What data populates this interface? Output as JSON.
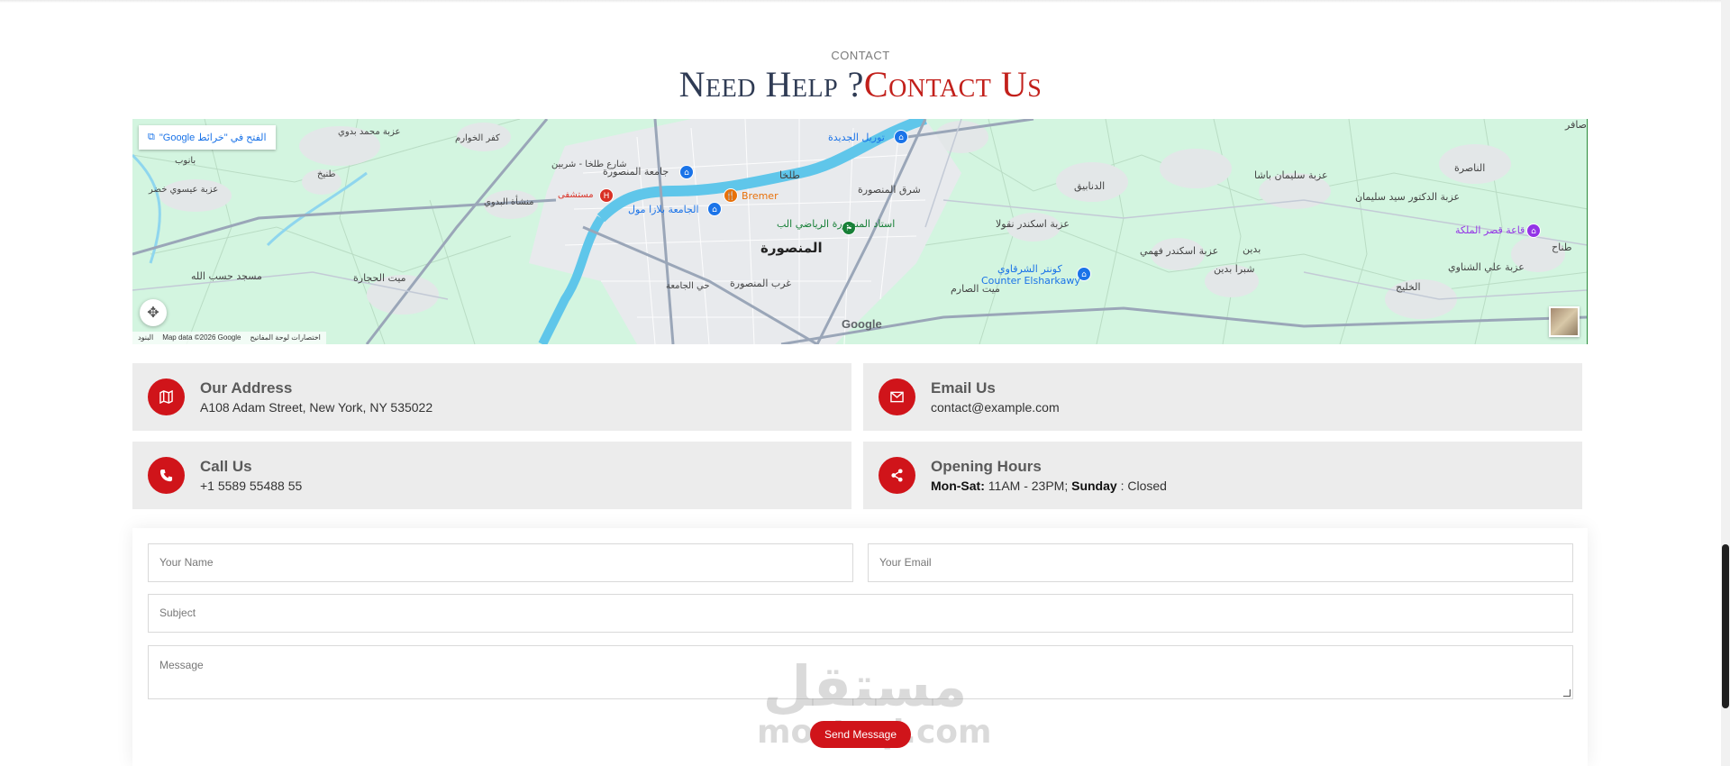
{
  "section": {
    "eyebrow": "CONTACT",
    "title_dark": "Need Help ?",
    "title_red": "Contact Us"
  },
  "map": {
    "open_link": "الفتح في \"خرائط Google\"",
    "footer_data": "Map data ©2026 Google",
    "footer_shortcuts": "اختصارات لوحة المفاتيح",
    "footer_terms": "البنود",
    "google": "Google",
    "labels": {
      "city": "المنصورة",
      "poi_university": "جامعة المنصورة",
      "poi_bremer": "Bremer",
      "poi_mall": "الجامعة بلازا مول",
      "poi_stadium": "استاد المنصورة الرياضي الب",
      "poi_counter": "Counter Elsharkawy",
      "poi_counter_ar": "كونتر الشرقاوي",
      "poi_palace": "قاعة قصر الملكة",
      "poi_toriel": "توريل الجديدة",
      "hospital": "مستشفى",
      "village_1": "عزبة محمد بدوي",
      "village_2": "كفر الخوارم",
      "village_3": "بانوب",
      "village_4": "طنيخ",
      "village_5": "عزبة عيسوي خضر",
      "village_6": "منشأة البدوي",
      "village_7": "طلخا",
      "village_8": "شرق المنصورة",
      "village_9": "الدنابيق",
      "village_10": "عزبة سليمان باشا",
      "village_11": "الناصرة",
      "village_12": "عزبة الدكتور سيد سليمان",
      "village_13": "عزبة اسكندر نقولا",
      "village_14": "عزبة اسكندر فهمي",
      "village_15": "بدين",
      "village_16": "شبرا بدين",
      "village_17": "ميت الحجارة",
      "village_18": "غرب المنصورة",
      "village_19": "ميت الصارم",
      "village_20": "الخليج",
      "village_21": "عزبة علي الشناوي",
      "village_22": "طناح",
      "village_23": "صافر",
      "village_24": "مسجد حسب الله",
      "village_25": "حي الجامعة",
      "village_26": "شارع طلخا - شربين"
    }
  },
  "info_cards": [
    {
      "title": "Our Address",
      "text": "A108 Adam Street, New York, NY 535022",
      "icon": "map-icon"
    },
    {
      "title": "Email Us",
      "text": "contact@example.com",
      "icon": "envelope-icon"
    },
    {
      "title": "Call Us",
      "text": "+1 5589 55488 55",
      "icon": "phone-icon"
    },
    {
      "title": "Opening Hours",
      "text_b1": "Mon-Sat:",
      "text_1": " 11AM - 23PM; ",
      "text_b2": "Sunday",
      "text_2": " : Closed",
      "icon": "share-icon"
    }
  ],
  "form": {
    "name_placeholder": "Your Name",
    "email_placeholder": "Your Email",
    "subject_placeholder": "Subject",
    "message_placeholder": "Message",
    "send_label": "Send Message"
  },
  "watermark": {
    "arabic": "مستقل",
    "latin": "mostaql.com"
  },
  "colors": {
    "accent": "#d0141a",
    "title_dark": "#2f3b54",
    "card_bg": "#ececec"
  }
}
